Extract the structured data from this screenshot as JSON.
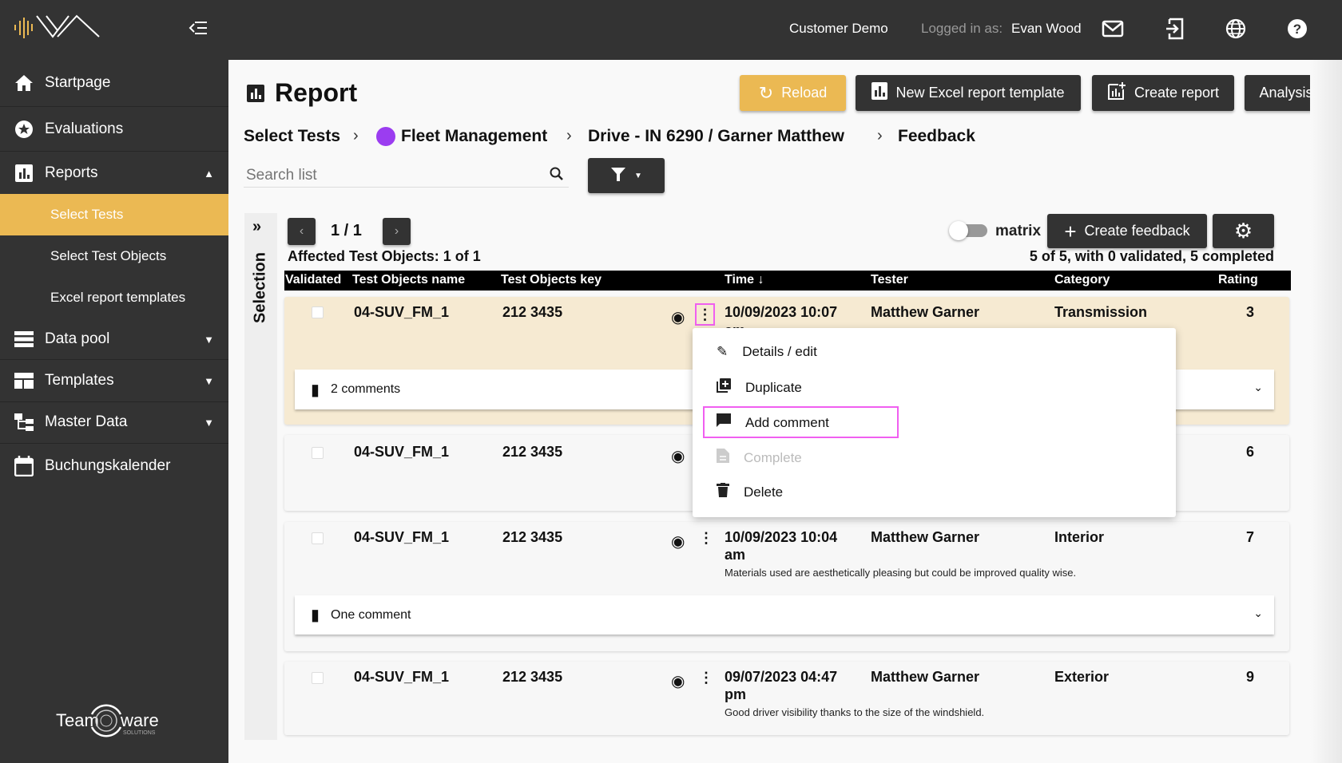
{
  "header": {
    "org": "Customer Demo",
    "logged_in_label": "Logged in as:",
    "user": "Evan Wood"
  },
  "sidebar": {
    "items": [
      {
        "label": "Startpage",
        "icon": "home-icon"
      },
      {
        "label": "Evaluations",
        "icon": "star-icon"
      },
      {
        "label": "Reports",
        "icon": "bar-chart-icon",
        "expanded": true
      },
      {
        "label": "Data pool",
        "icon": "list-icon"
      },
      {
        "label": "Templates",
        "icon": "table-icon"
      },
      {
        "label": "Master Data",
        "icon": "hierarchy-icon"
      },
      {
        "label": "Buchungskalender",
        "icon": "calendar-icon"
      }
    ],
    "subitems": [
      {
        "label": "Select Tests",
        "active": true
      },
      {
        "label": "Select Test Objects"
      },
      {
        "label": "Excel report templates"
      }
    ],
    "brand_logo_text": "Team ware SOLUTIONS"
  },
  "page": {
    "title": "Report",
    "buttons": {
      "reload": "Reload",
      "new_excel": "New Excel report template",
      "create_report": "Create report",
      "analysis": "Analysis"
    },
    "breadcrumb": [
      "Select Tests",
      "Fleet Management",
      "Drive - IN 6290 / Garner Matthew",
      "Feedback"
    ],
    "breadcrumb_dot_color": "#9b3df0",
    "search_placeholder": "Search list"
  },
  "selection_label": "Selection",
  "pager": {
    "text": "1 / 1"
  },
  "affected": "Affected Test Objects: 1 of 1",
  "matrix_label": "matrix",
  "matrix_on": false,
  "create_feedback": "Create feedback",
  "summary": "5 of 5, with 0 validated, 5 completed",
  "table": {
    "columns": [
      "Validated",
      "Test Objects name",
      "Test Objects key",
      "Time",
      "Tester",
      "Category",
      "Rating"
    ],
    "rows": [
      {
        "name": "04-SUV_FM_1",
        "key": "212 3435",
        "time": "10/09/2023 10:07",
        "time2": "am",
        "tester": "Matthew Garner",
        "category": "Transmission",
        "rating": "3",
        "comments": "2 comments",
        "highlighted": true
      },
      {
        "name": "04-SUV_FM_1",
        "key": "212 3435",
        "rating": "6"
      },
      {
        "name": "04-SUV_FM_1",
        "key": "212 3435",
        "time": "10/09/2023 10:04",
        "time2": "am",
        "tester": "Matthew Garner",
        "category": "Interior",
        "rating": "7",
        "desc": "Materials used are aesthetically pleasing but could be improved quality wise.",
        "comments": "One comment"
      },
      {
        "name": "04-SUV_FM_1",
        "key": "212 3435",
        "time": "09/07/2023 04:47",
        "time2": "pm",
        "tester": "Matthew Garner",
        "category": "Exterior",
        "rating": "9",
        "desc": "Good driver visibility thanks to the size of the windshield."
      }
    ]
  },
  "context_menu": {
    "items": [
      "Details / edit",
      "Duplicate",
      "Add comment",
      "Complete",
      "Delete"
    ],
    "disabled": [
      "Complete"
    ],
    "highlighted": "Add comment"
  },
  "colors": {
    "accent": "#ebb953",
    "dark": "#333333",
    "highlight_row": "#f6ead2",
    "focus": "#f05ff0"
  }
}
